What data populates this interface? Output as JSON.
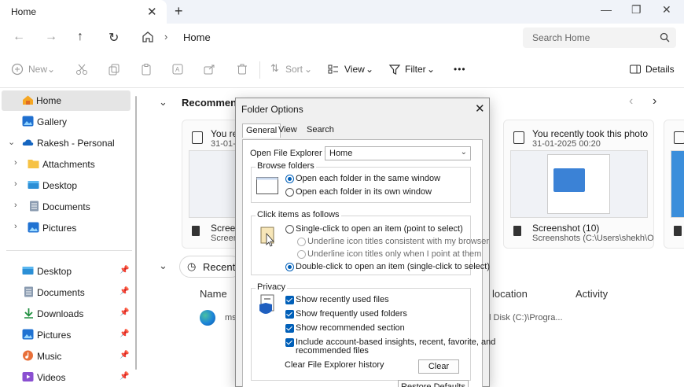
{
  "window": {
    "tab_label": "Home",
    "tab_close": "✕",
    "tab_add": "+",
    "minimize": "—",
    "restore": "❐",
    "close": "✕"
  },
  "address": {
    "back": "←",
    "forward": "→",
    "up": "↑",
    "refresh": "↻",
    "separator": "›",
    "path": "Home",
    "search_placeholder": "Search Home"
  },
  "toolbar": {
    "new_label": "New",
    "sort_label": "Sort",
    "view_label": "View",
    "filter_label": "Filter",
    "more_label": "•••",
    "details_label": "Details"
  },
  "sidebar": {
    "items": [
      {
        "label": "Home"
      },
      {
        "label": "Gallery"
      },
      {
        "label": "Rakesh - Personal"
      },
      {
        "label": "Attachments"
      },
      {
        "label": "Desktop"
      },
      {
        "label": "Documents"
      },
      {
        "label": "Pictures"
      }
    ],
    "quick": [
      {
        "label": "Desktop"
      },
      {
        "label": "Documents"
      },
      {
        "label": "Downloads"
      },
      {
        "label": "Pictures"
      },
      {
        "label": "Music"
      },
      {
        "label": "Videos"
      }
    ]
  },
  "main": {
    "recommended_title": "Recommende",
    "recent_title": "Recent",
    "cards": [
      {
        "title": "You re",
        "date": "31-01-",
        "name": "Screen",
        "path": "Screen"
      },
      {
        "title": "You recently took this photo",
        "date": "31-01-2025 00:20",
        "name": "Screenshot (10)",
        "path": "Screenshots (C:\\Users\\shekh\\O..."
      }
    ],
    "columns": {
      "name": "Name",
      "location": "location",
      "activity": "Activity"
    },
    "row": {
      "name": "ms",
      "location": "l Disk (C:)\\Progra..."
    }
  },
  "dialog": {
    "title": "Folder Options",
    "close": "✕",
    "tabs": [
      "General",
      "View",
      "Search"
    ],
    "open_label": "Open File Explorer to:",
    "open_value": "Home",
    "browse_title": "Browse folders",
    "browse_same": "Open each folder in the same window",
    "browse_own": "Open each folder in its own window",
    "click_title": "Click items as follows",
    "single_click": "Single-click to open an item (point to select)",
    "underline_consistent": "Underline icon titles consistent with my browser",
    "underline_point": "Underline icon titles only when I point at them",
    "double_click": "Double-click to open an item (single-click to select)",
    "privacy_title": "Privacy",
    "show_recent": "Show recently used files",
    "show_frequent": "Show frequently used folders",
    "show_recommended": "Show recommended section",
    "include_account_1": "Include account-based insights, recent, favorite, and",
    "include_account_2": "recommended files",
    "clear_history": "Clear File Explorer history",
    "clear_button": "Clear",
    "restore_defaults": "Restore Defaults"
  }
}
